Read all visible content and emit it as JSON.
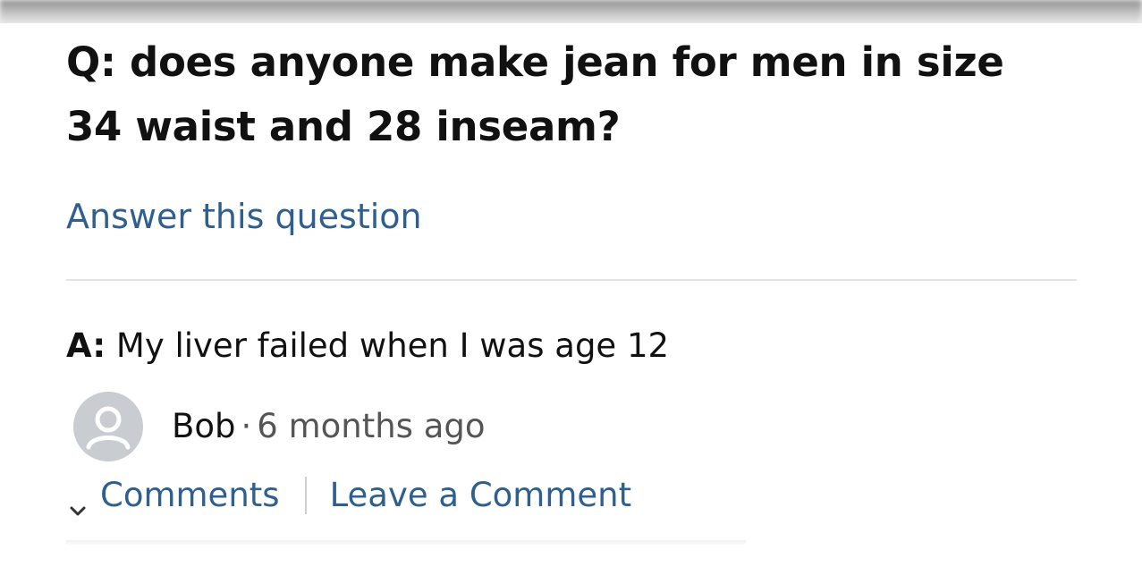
{
  "question": {
    "prefix": "Q:",
    "text": "does anyone make jean for men in size 34 waist and 28 inseam?"
  },
  "answer_link": "Answer this question",
  "answer": {
    "prefix": "A:",
    "text": "My liver failed when I was age 12"
  },
  "author": {
    "name": "Bob",
    "separator": "·",
    "date": "6 months ago"
  },
  "actions": {
    "comments": "Comments",
    "leave_comment": "Leave a Comment"
  },
  "icons": {
    "avatar": "user-avatar-icon",
    "chevron": "chevron-down-icon"
  },
  "colors": {
    "link": "#2f5f8f",
    "text": "#111111",
    "avatar_bg": "#c9ccd0"
  }
}
